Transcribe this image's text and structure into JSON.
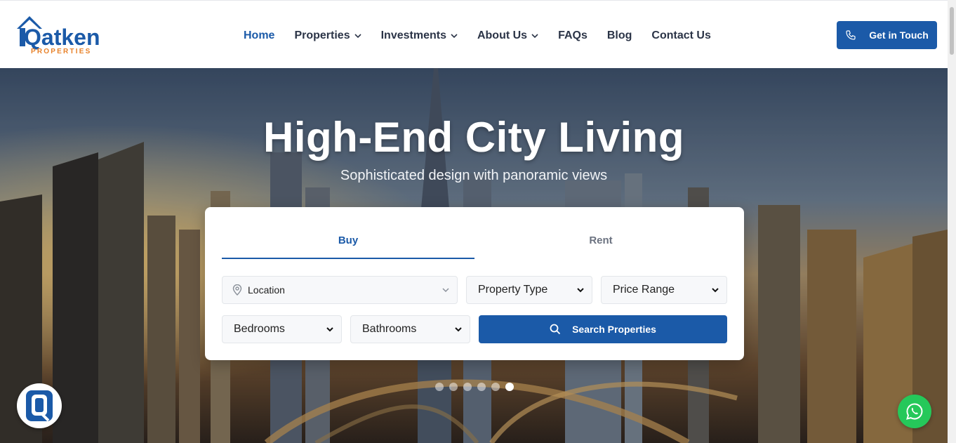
{
  "brand": {
    "logo_word": "Qatken",
    "logo_sub": "PROPERTIES",
    "primary_color": "#1b5aa8",
    "accent_color": "#e8822a"
  },
  "nav": {
    "items": [
      {
        "label": "Home",
        "active": true,
        "dropdown": false
      },
      {
        "label": "Properties",
        "active": false,
        "dropdown": true
      },
      {
        "label": "Investments",
        "active": false,
        "dropdown": true
      },
      {
        "label": "About Us",
        "active": false,
        "dropdown": true
      },
      {
        "label": "FAQs",
        "active": false,
        "dropdown": false
      },
      {
        "label": "Blog",
        "active": false,
        "dropdown": false
      },
      {
        "label": "Contact Us",
        "active": false,
        "dropdown": false
      }
    ],
    "cta_label": "Get in Touch",
    "cta_icon": "phone-icon"
  },
  "hero": {
    "title": "High-End City Living",
    "subtitle": "Sophisticated design with panoramic views",
    "slide_count": 6,
    "active_slide": 6
  },
  "search": {
    "tabs": [
      {
        "label": "Buy",
        "active": true
      },
      {
        "label": "Rent",
        "active": false
      }
    ],
    "location_placeholder": "Location",
    "property_type": "Property Type",
    "price_range": "Price Range",
    "bedrooms": "Bedrooms",
    "bathrooms": "Bathrooms",
    "submit_label": "Search Properties"
  },
  "floating": {
    "whatsapp_color": "#25c85a"
  }
}
